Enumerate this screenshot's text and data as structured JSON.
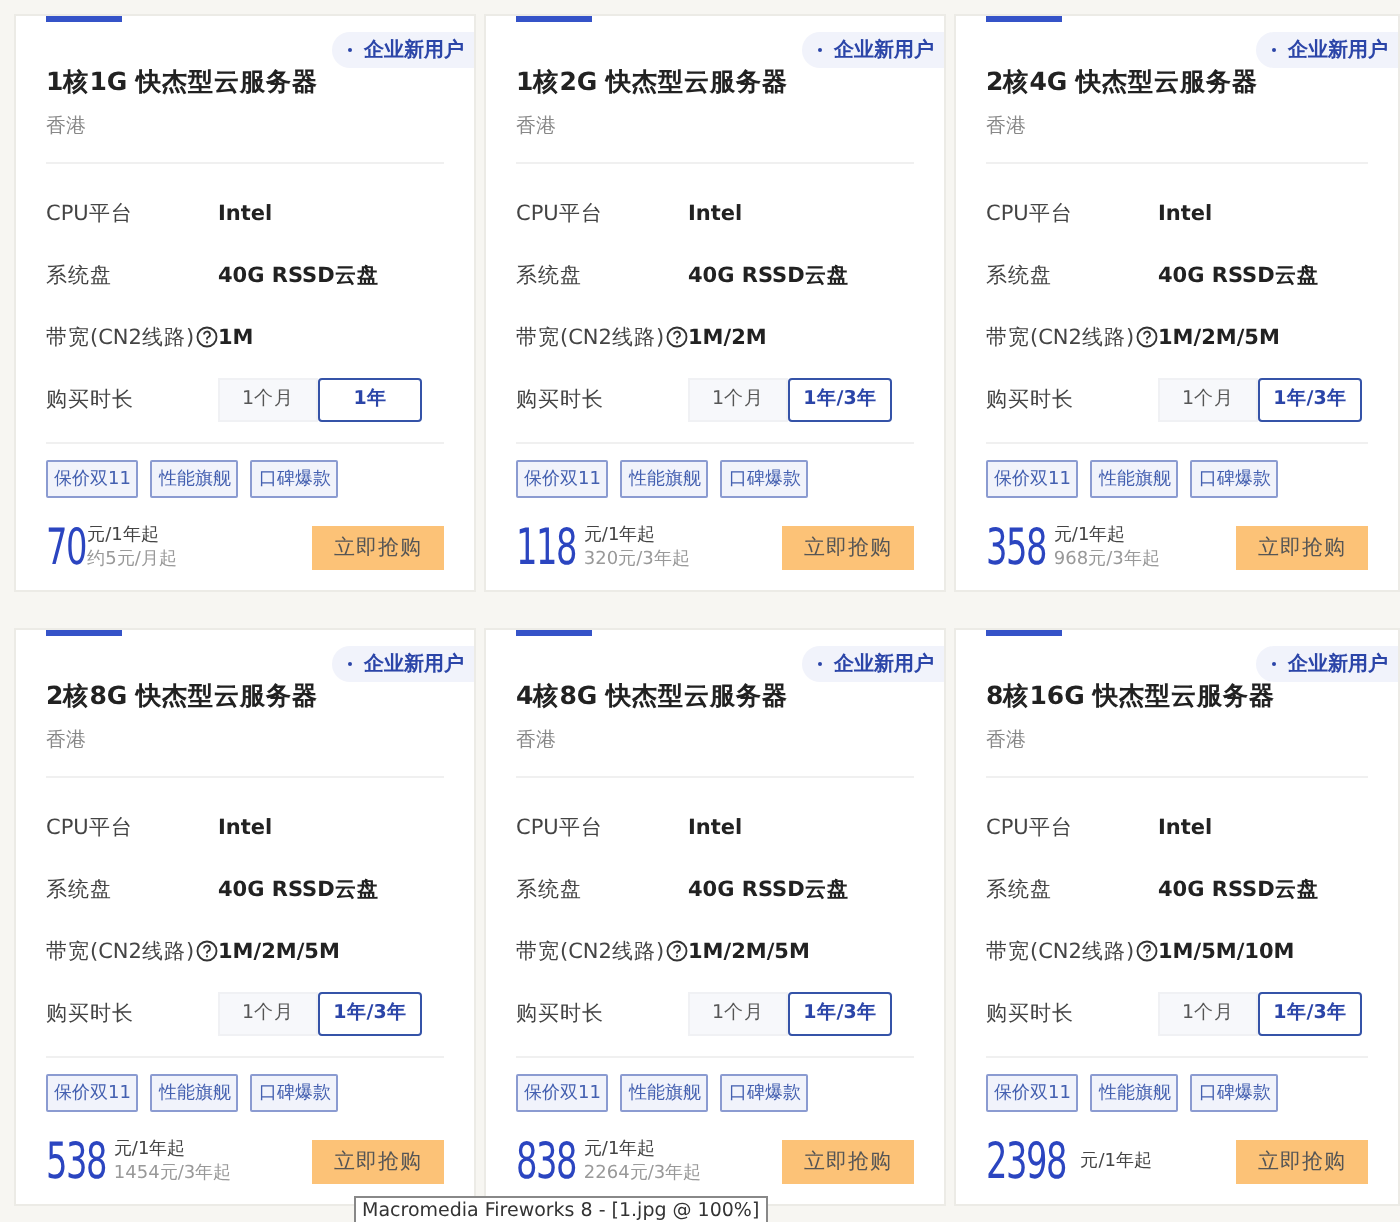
{
  "cards": [
    {
      "badge": "企业新用户",
      "title": "1核1G 快杰型云服务器",
      "region": "香港",
      "specs": [
        {
          "label": "CPU平台",
          "value": "Intel"
        },
        {
          "label": "系统盘",
          "value": "40G RSSD云盘"
        },
        {
          "label": "带宽(CN2线路)",
          "value": "1M",
          "help": true
        }
      ],
      "duration_label": "购买时长",
      "durations": [
        {
          "label": "1个月",
          "selected": false
        },
        {
          "label": "1年",
          "selected": true
        }
      ],
      "tags": [
        "保价双11",
        "性能旗舰",
        "口碑爆款"
      ],
      "price": "70",
      "price_unit": "元/1年起",
      "price_note": "约5元/月起",
      "buy": "立即抢购"
    },
    {
      "badge": "企业新用户",
      "title": "1核2G 快杰型云服务器",
      "region": "香港",
      "specs": [
        {
          "label": "CPU平台",
          "value": "Intel"
        },
        {
          "label": "系统盘",
          "value": "40G RSSD云盘"
        },
        {
          "label": "带宽(CN2线路)",
          "value": "1M/2M",
          "help": true
        }
      ],
      "duration_label": "购买时长",
      "durations": [
        {
          "label": "1个月",
          "selected": false
        },
        {
          "label": "1年/3年",
          "selected": true
        }
      ],
      "tags": [
        "保价双11",
        "性能旗舰",
        "口碑爆款"
      ],
      "price": "118",
      "price_unit": "元/1年起",
      "price_note": "320元/3年起",
      "buy": "立即抢购"
    },
    {
      "badge": "企业新用户",
      "title": "2核4G 快杰型云服务器",
      "region": "香港",
      "specs": [
        {
          "label": "CPU平台",
          "value": "Intel"
        },
        {
          "label": "系统盘",
          "value": "40G RSSD云盘"
        },
        {
          "label": "带宽(CN2线路)",
          "value": "1M/2M/5M",
          "help": true
        }
      ],
      "duration_label": "购买时长",
      "durations": [
        {
          "label": "1个月",
          "selected": false
        },
        {
          "label": "1年/3年",
          "selected": true
        }
      ],
      "tags": [
        "保价双11",
        "性能旗舰",
        "口碑爆款"
      ],
      "price": "358",
      "price_unit": "元/1年起",
      "price_note": "968元/3年起",
      "buy": "立即抢购"
    },
    {
      "badge": "企业新用户",
      "title": "2核8G 快杰型云服务器",
      "region": "香港",
      "specs": [
        {
          "label": "CPU平台",
          "value": "Intel"
        },
        {
          "label": "系统盘",
          "value": "40G RSSD云盘"
        },
        {
          "label": "带宽(CN2线路)",
          "value": "1M/2M/5M",
          "help": true
        }
      ],
      "duration_label": "购买时长",
      "durations": [
        {
          "label": "1个月",
          "selected": false
        },
        {
          "label": "1年/3年",
          "selected": true
        }
      ],
      "tags": [
        "保价双11",
        "性能旗舰",
        "口碑爆款"
      ],
      "price": "538",
      "price_unit": "元/1年起",
      "price_note": "1454元/3年起",
      "buy": "立即抢购"
    },
    {
      "badge": "企业新用户",
      "title": "4核8G 快杰型云服务器",
      "region": "香港",
      "specs": [
        {
          "label": "CPU平台",
          "value": "Intel"
        },
        {
          "label": "系统盘",
          "value": "40G RSSD云盘"
        },
        {
          "label": "带宽(CN2线路)",
          "value": "1M/2M/5M",
          "help": true
        }
      ],
      "duration_label": "购买时长",
      "durations": [
        {
          "label": "1个月",
          "selected": false
        },
        {
          "label": "1年/3年",
          "selected": true
        }
      ],
      "tags": [
        "保价双11",
        "性能旗舰",
        "口碑爆款"
      ],
      "price": "838",
      "price_unit": "元/1年起",
      "price_note": "2264元/3年起",
      "buy": "立即抢购"
    },
    {
      "badge": "企业新用户",
      "title": "8核16G 快杰型云服务器",
      "region": "香港",
      "specs": [
        {
          "label": "CPU平台",
          "value": "Intel"
        },
        {
          "label": "系统盘",
          "value": "40G RSSD云盘"
        },
        {
          "label": "带宽(CN2线路)",
          "value": "1M/5M/10M",
          "help": true
        }
      ],
      "duration_label": "购买时长",
      "durations": [
        {
          "label": "1个月",
          "selected": false
        },
        {
          "label": "1年/3年",
          "selected": true
        }
      ],
      "tags": [
        "保价双11",
        "性能旗舰",
        "口碑爆款"
      ],
      "price": "2398",
      "price_unit": "元/1年起",
      "buy": "立即抢购"
    }
  ],
  "tooltip": "Macromedia Fireworks 8 - [1.jpg @ 100%]"
}
